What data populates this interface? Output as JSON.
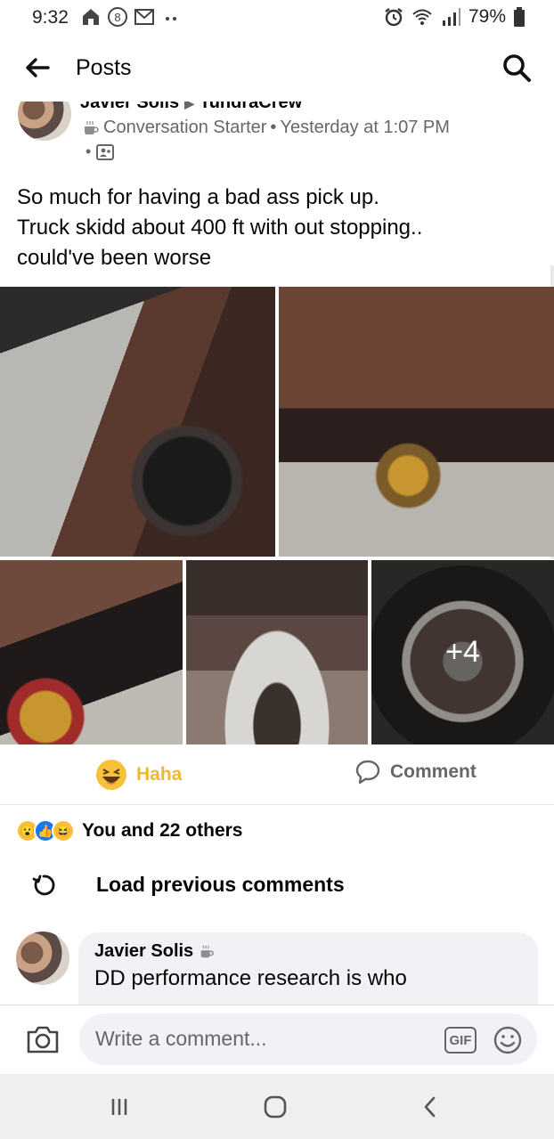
{
  "status_bar": {
    "time": "9:32",
    "battery": "79%",
    "left_icons": [
      "home-icon",
      "8-badge-icon",
      "mail-icon",
      "more-dots-icon"
    ],
    "right_icons": [
      "alarm-icon",
      "wifi-icon",
      "signal-icon",
      "battery-icon"
    ]
  },
  "header": {
    "title": "Posts"
  },
  "post": {
    "author": "Javier Solis",
    "group": "TundraCrew",
    "badge": "Conversation Starter",
    "separator": "•",
    "timestamp": "Yesterday at 1:07 PM",
    "audience_dot": "•",
    "text_lines": [
      "So much for having a bad ass pick up.",
      "Truck skidd about 400 ft with out stopping..",
      "could've been worse"
    ],
    "more_photos": "+4"
  },
  "actions": {
    "reaction_label": "Haha",
    "comment_label": "Comment"
  },
  "reactions": {
    "summary": "You and 22 others"
  },
  "comments": {
    "load_previous": "Load previous comments",
    "items": [
      {
        "author": "Javier Solis",
        "text": "DD performance research is who"
      }
    ]
  },
  "composer": {
    "placeholder": "Write a comment...",
    "gif_label": "GIF"
  },
  "colors": {
    "haha": "#f0b82d",
    "secondary_text": "#65676b",
    "bubble_bg": "#f0f2f5",
    "like_blue": "#1877f2"
  }
}
